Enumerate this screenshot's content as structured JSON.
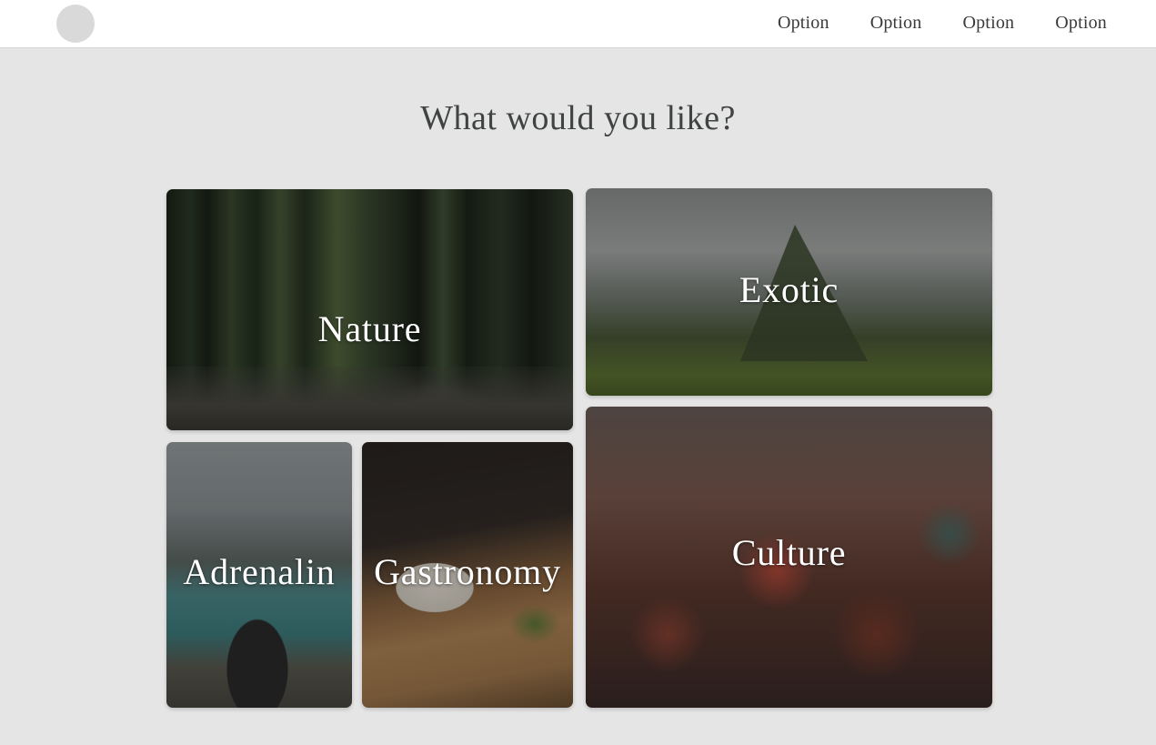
{
  "header": {
    "logo": "avatar",
    "nav": [
      "Option",
      "Option",
      "Option",
      "Option"
    ]
  },
  "main": {
    "title": "What would you like?",
    "cards": {
      "nature": "Nature",
      "exotic": "Exotic",
      "culture": "Culture",
      "adrenalin": "Adrenalin",
      "gastronomy": "Gastronomy"
    }
  },
  "colors": {
    "page_background": "#e5e5e5",
    "header_background": "#ffffff",
    "title_text": "#3f4442",
    "card_label_text": "#ffffff"
  }
}
